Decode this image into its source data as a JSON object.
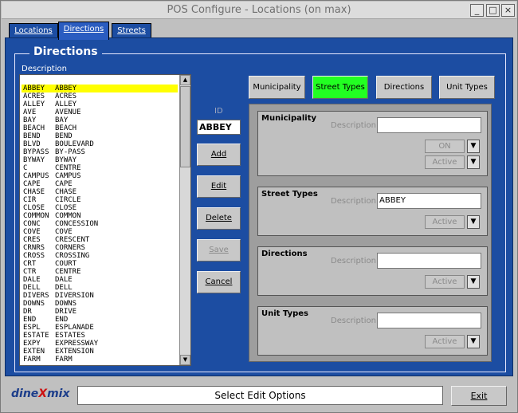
{
  "window": {
    "title": "POS Configure - Locations (on max)"
  },
  "titlebar_buttons": {
    "minimize": "_",
    "maximize": "□",
    "close": "×"
  },
  "tabs": [
    {
      "label": "Locations",
      "active": false
    },
    {
      "label": "Directions",
      "active": true
    },
    {
      "label": "Streets",
      "active": false
    }
  ],
  "section": {
    "title": "Directions",
    "list_label": "Description"
  },
  "list": [
    {
      "code": "ABBEY",
      "name": "ABBEY",
      "selected": true
    },
    {
      "code": "ACRES",
      "name": "ACRES"
    },
    {
      "code": "ALLEY",
      "name": "ALLEY"
    },
    {
      "code": "AVE",
      "name": "AVENUE"
    },
    {
      "code": "BAY",
      "name": "BAY"
    },
    {
      "code": "BEACH",
      "name": "BEACH"
    },
    {
      "code": "BEND",
      "name": "BEND"
    },
    {
      "code": "BLVD",
      "name": "BOULEVARD"
    },
    {
      "code": "BYPASS",
      "name": "BY-PASS"
    },
    {
      "code": "BYWAY",
      "name": "BYWAY"
    },
    {
      "code": "C",
      "name": "CENTRE"
    },
    {
      "code": "CAMPUS",
      "name": "CAMPUS"
    },
    {
      "code": "CAPE",
      "name": "CAPE"
    },
    {
      "code": "CHASE",
      "name": "CHASE"
    },
    {
      "code": "CIR",
      "name": "CIRCLE"
    },
    {
      "code": "CLOSE",
      "name": "CLOSE"
    },
    {
      "code": "COMMON",
      "name": "COMMON"
    },
    {
      "code": "CONC",
      "name": "CONCESSION"
    },
    {
      "code": "COVE",
      "name": "COVE"
    },
    {
      "code": "CRES",
      "name": "CRESCENT"
    },
    {
      "code": "CRNRS",
      "name": "CORNERS"
    },
    {
      "code": "CROSS",
      "name": "CROSSING"
    },
    {
      "code": "CRT",
      "name": "COURT"
    },
    {
      "code": "CTR",
      "name": "CENTRE"
    },
    {
      "code": "DALE",
      "name": "DALE"
    },
    {
      "code": "DELL",
      "name": "DELL"
    },
    {
      "code": "DIVERS",
      "name": "DIVERSION"
    },
    {
      "code": "DOWNS",
      "name": "DOWNS"
    },
    {
      "code": "DR",
      "name": "DRIVE"
    },
    {
      "code": "END",
      "name": "END"
    },
    {
      "code": "ESPL",
      "name": "ESPLANADE"
    },
    {
      "code": "ESTATE",
      "name": "ESTATES"
    },
    {
      "code": "EXPY",
      "name": "EXPRESSWAY"
    },
    {
      "code": "EXTEN",
      "name": "EXTENSION"
    },
    {
      "code": "FARM",
      "name": "FARM"
    }
  ],
  "scroll": {
    "up": "▲",
    "down": "▼"
  },
  "id_field": {
    "label": "ID",
    "value": "ABBEY"
  },
  "actions": {
    "add": "Add",
    "edit": "Edit",
    "delete": "Delete",
    "save": "Save",
    "cancel": "Cancel"
  },
  "category_buttons": {
    "municipality": "Municipality",
    "street_types": "Street Types",
    "directions": "Directions",
    "unit_types": "Unit Types",
    "active_color": "#22ff22"
  },
  "sections": {
    "municipality": {
      "title": "Municipality",
      "desc_label": "Description",
      "desc_value": "",
      "on_label": "ON",
      "active_label": "Active",
      "arrow": "▼"
    },
    "street_types": {
      "title": "Street Types",
      "desc_label": "Description",
      "desc_value": "ABBEY",
      "active_label": "Active",
      "arrow": "▼"
    },
    "directions": {
      "title": "Directions",
      "desc_label": "Description",
      "desc_value": "",
      "active_label": "Active",
      "arrow": "▼"
    },
    "unit_types": {
      "title": "Unit Types",
      "desc_label": "Description",
      "desc_value": "",
      "active_label": "Active",
      "arrow": "▼"
    }
  },
  "footer": {
    "logo_left": "dine",
    "logo_mark": "X",
    "logo_right": "mix",
    "status": "Select Edit Options",
    "exit": "Exit"
  },
  "colors": {
    "panel": "#1c4da2",
    "highlight": "#ffff00"
  }
}
